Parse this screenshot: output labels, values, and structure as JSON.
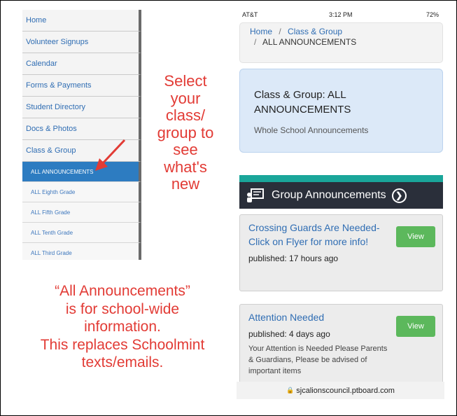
{
  "sidebar": {
    "items": [
      {
        "label": "Home"
      },
      {
        "label": "Volunteer Signups"
      },
      {
        "label": "Calendar"
      },
      {
        "label": "Forms & Payments"
      },
      {
        "label": "Student Directory"
      },
      {
        "label": "Docs & Photos"
      },
      {
        "label": "Class & Group"
      }
    ],
    "sub_items": [
      {
        "label": "ALL ANNOUNCEMENTS",
        "active": true
      },
      {
        "label": "ALL Eighth Grade"
      },
      {
        "label": "ALL Fifth Grade"
      },
      {
        "label": "ALL Tenth Grade"
      },
      {
        "label": "ALL Third Grade"
      }
    ]
  },
  "annotations": {
    "select_lines": [
      "Select",
      "your",
      "class/",
      "group to",
      "see",
      "what's",
      "new"
    ],
    "bottom_lines": [
      "“All Announcements”",
      "is for school-wide",
      "information.",
      "This replaces Schoolmint",
      "texts/emails."
    ],
    "color": "#e23b35"
  },
  "phone": {
    "status": {
      "carrier": "AT&T",
      "time": "3:12 PM",
      "battery": "72%"
    },
    "breadcrumb": {
      "home": "Home",
      "parent": "Class & Group",
      "current": "ALL ANNOUNCEMENTS",
      "separator": "/"
    },
    "page_title": "Class & Group: ALL ANNOUNCEMENTS",
    "page_subtitle": "Whole School Announcements",
    "group_bar_label": "Group Announcements",
    "announcements": [
      {
        "title": "Crossing Guards Are Needed- Click on Flyer for more info!",
        "published": "published: 17 hours ago",
        "body": "",
        "button": "View"
      },
      {
        "title": "Attention Needed",
        "published": "published: 4 days ago",
        "body": "Your Attention is Needed Please Parents & Guardians, Please be advised of important items",
        "button": "View"
      }
    ],
    "url": "sjcalionscouncil.ptboard.com"
  },
  "colors": {
    "accent": "#2d7cc1",
    "button": "#5cb85c",
    "teal": "#1aa69a",
    "dark_bar": "#2a2f3a"
  }
}
